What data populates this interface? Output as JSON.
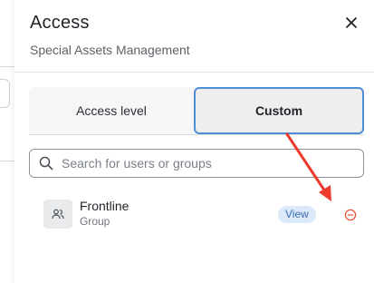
{
  "panel": {
    "title": "Access",
    "subtitle": "Special Assets Management"
  },
  "tabs": [
    {
      "label": "Access level",
      "selected": false
    },
    {
      "label": "Custom",
      "selected": true
    }
  ],
  "search": {
    "placeholder": "Search for users or groups"
  },
  "entries": [
    {
      "name": "Frontline",
      "type": "Group",
      "role": "View"
    }
  ],
  "icons": {
    "close": "close-icon",
    "search": "search-icon",
    "group": "users-icon",
    "remove": "remove-circle-icon"
  },
  "colors": {
    "selected_tab_border": "#4f8ed6",
    "role_badge_bg": "#dce9f8",
    "role_badge_text": "#3b6fb3",
    "remove_icon": "#e5533d",
    "annotation_arrow": "#ee3a2d"
  }
}
